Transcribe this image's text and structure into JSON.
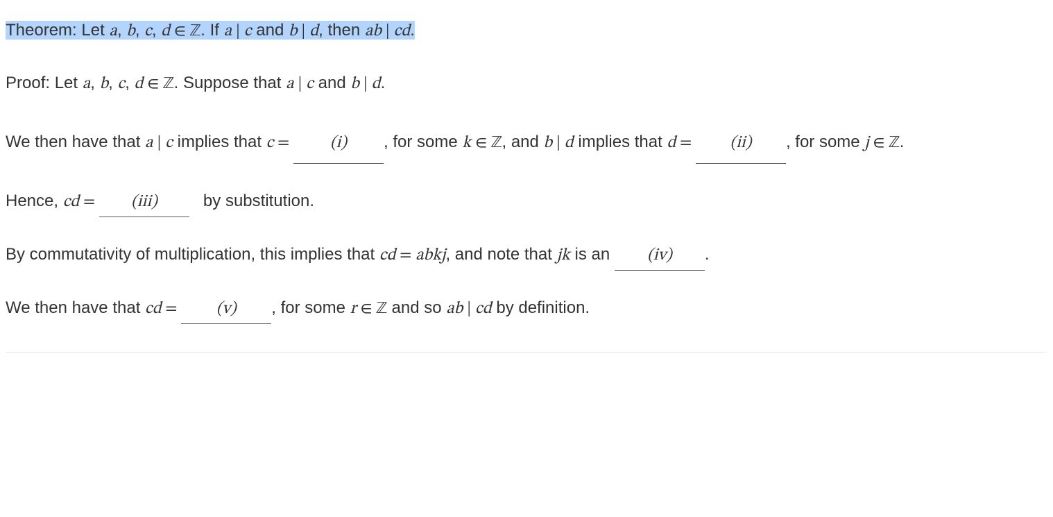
{
  "theorem": {
    "label": "Theorem: Let ",
    "vars1": "a",
    "comma1": ", ",
    "vars2": "b",
    "comma2": ", ",
    "vars3": "c",
    "comma3": ", ",
    "vars4": "d",
    "in": " ∈ ",
    "set": "ℤ",
    "period1": ". If ",
    "a2": "a",
    "div1": " | ",
    "c2": "c",
    "and1": " and ",
    "b2": "b",
    "div2": " | ",
    "d2": "d",
    "then": ", then ",
    "ab": "ab",
    "div3": " | ",
    "cd": "cd",
    "period2": "."
  },
  "proof": {
    "label": "Proof: Let ",
    "vars1": "a",
    "comma1": ", ",
    "vars2": "b",
    "comma2": ", ",
    "vars3": "c",
    "comma3": ", ",
    "vars4": "d",
    "in": " ∈ ",
    "set": "ℤ",
    "period1": ". Suppose that ",
    "a2": "a",
    "div1": " | ",
    "c2": "c",
    "and1": " and ",
    "b2": "b",
    "div2": " | ",
    "d2": "d",
    "period2": "."
  },
  "line3": {
    "t1": "We then have that ",
    "a": "a",
    "div1": " | ",
    "c": "c",
    "t2": " implies that ",
    "c2": "c",
    "eq1": " = ",
    "blank_i": "(i)",
    "t3": ", for some ",
    "k": "k",
    "in1": " ∈ ",
    "set1": "ℤ",
    "t3b": ", and ",
    "b": "b",
    "div2": " | ",
    "d": "d",
    "t4": " implies that ",
    "d2": "d",
    "eq2": " = ",
    "blank_ii": "(ii)",
    "t5": ", for some ",
    "j": "j",
    "in2": " ∈ ",
    "set2": "ℤ",
    "t6": "."
  },
  "line4": {
    "t1": "Hence, ",
    "cd": "cd",
    "eq": " = ",
    "blank_iii": "(iii)",
    "t2": " by substitution."
  },
  "line5": {
    "t1": "By commutativity of multiplication, this implies that ",
    "cd": "cd",
    "eq": " = ",
    "abkj": "abkj",
    "t2": ", and note that ",
    "jk": "jk",
    "t3": " is an ",
    "blank_iv": "(iv)",
    "t4": "."
  },
  "line6": {
    "t1": "We then have that ",
    "cd": "cd",
    "eq": " = ",
    "blank_v": "(v)",
    "t2": ", for some ",
    "r": "r",
    "in": " ∈ ",
    "set": "ℤ",
    "t3": " and so ",
    "ab": "ab",
    "div": " | ",
    "cd2": "cd",
    "t4": " by definition."
  }
}
